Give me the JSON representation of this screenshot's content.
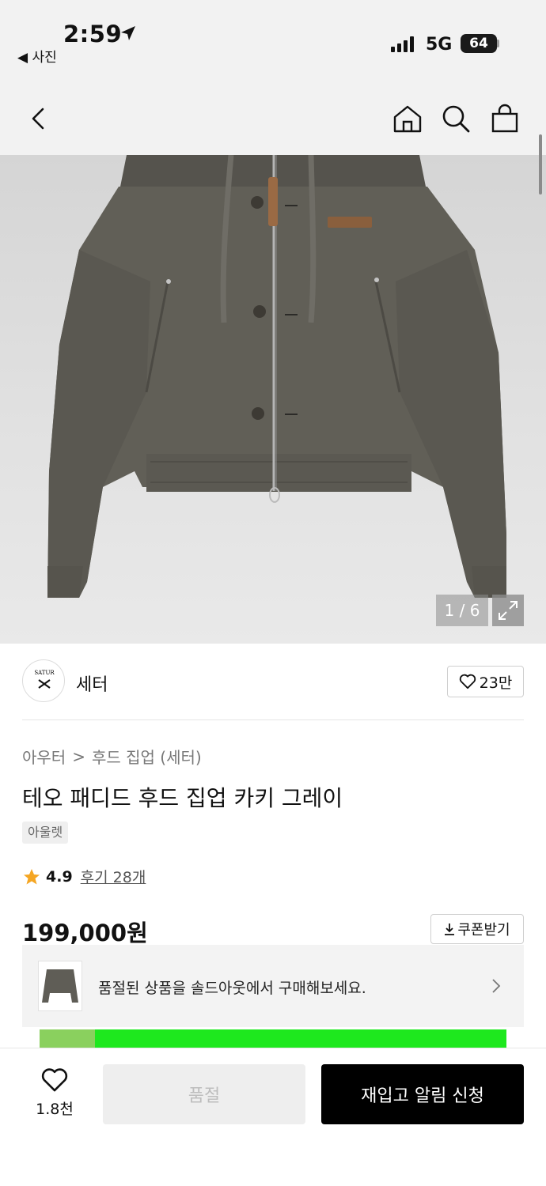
{
  "status_bar": {
    "time": "2:59",
    "back_app": "◀ 사진",
    "network": "5G",
    "battery": "64"
  },
  "nav": {
    "icons": [
      "chevron-left-icon",
      "home-icon",
      "search-icon",
      "shopping-bag-icon"
    ]
  },
  "gallery": {
    "counter": "1 / 6",
    "logo_text": "SATUR"
  },
  "brand": {
    "name": "세터",
    "likes": "23만",
    "logo_text": "SATUR"
  },
  "breadcrumb": {
    "level1": "아우터",
    "separator": ">",
    "level2": "후드 집업 (세터)"
  },
  "product": {
    "title": "테오 패디드 후드 집업 카키 그레이",
    "tag": "아울렛",
    "rating": "4.9",
    "reviews": "후기 28개",
    "price": "199,000원"
  },
  "coupon": {
    "label": "쿠폰받기"
  },
  "soldout_banner": {
    "text": "품절된 상품을 솔드아웃에서 구매해보세요."
  },
  "bottom_bar": {
    "wish_count": "1.8천",
    "soldout_label": "품절",
    "restock_label": "재입고 알림 신청"
  },
  "colors": {
    "accent_star": "#f5a623",
    "promo_green": "#1ee81e",
    "jacket": "#5f5d56",
    "primary_button": "#000000"
  }
}
